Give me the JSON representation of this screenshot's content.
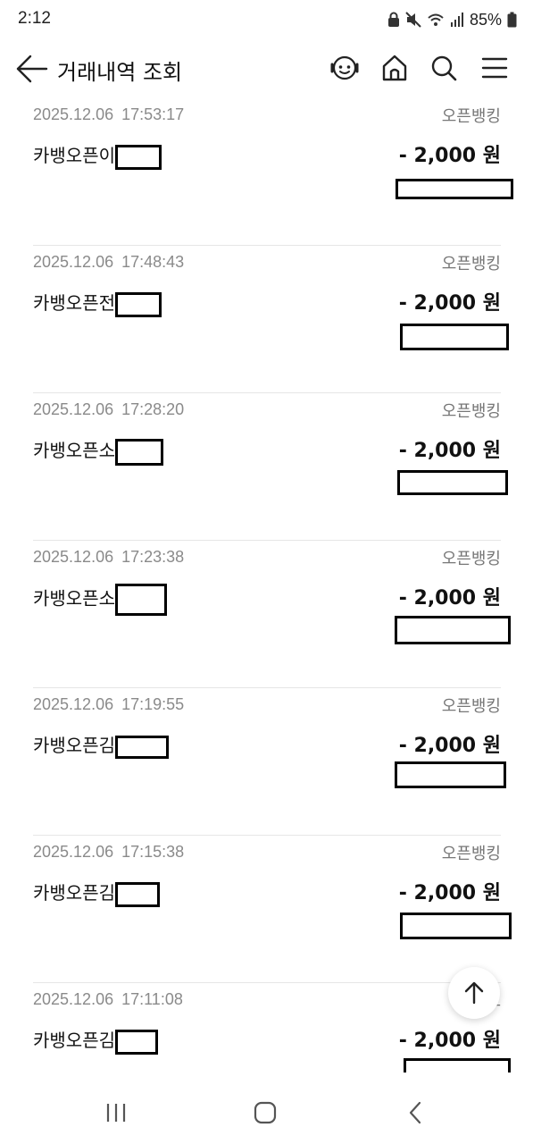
{
  "status_bar": {
    "time": "2:12",
    "battery": "85%",
    "icons": [
      "lock-icon",
      "mute-icon",
      "wifi-icon",
      "signal-icon",
      "battery-icon"
    ]
  },
  "header": {
    "title": "거래내역 조회",
    "icons": [
      "back-arrow-icon",
      "chatbot-face-icon",
      "home-icon",
      "search-icon",
      "menu-icon"
    ]
  },
  "transactions": [
    {
      "date": "2025.12.06",
      "time": "17:53:17",
      "type": "오픈뱅킹",
      "name": "카뱅오픈이",
      "amount": "- 2,000 원"
    },
    {
      "date": "2025.12.06",
      "time": "17:48:43",
      "type": "오픈뱅킹",
      "name": "카뱅오픈전",
      "amount": "- 2,000 원"
    },
    {
      "date": "2025.12.06",
      "time": "17:28:20",
      "type": "오픈뱅킹",
      "name": "카뱅오픈소",
      "amount": "- 2,000 원"
    },
    {
      "date": "2025.12.06",
      "time": "17:23:38",
      "type": "오픈뱅킹",
      "name": "카뱅오픈소",
      "amount": "- 2,000 원"
    },
    {
      "date": "2025.12.06",
      "time": "17:19:55",
      "type": "오픈뱅킹",
      "name": "카뱅오픈김",
      "amount": "- 2,000 원"
    },
    {
      "date": "2025.12.06",
      "time": "17:15:38",
      "type": "오픈뱅킹",
      "name": "카뱅오픈김",
      "amount": "- 2,000 원"
    },
    {
      "date": "2025.12.06",
      "time": "17:11:08",
      "type": "오",
      "name": "카뱅오픈김",
      "amount": "- 2,000 원"
    }
  ],
  "floating": {
    "icon": "arrow-up-icon"
  },
  "nav": {
    "icons": [
      "recent-apps-icon",
      "home-button-icon",
      "back-button-icon"
    ]
  },
  "colors": {
    "background": "#ffffff",
    "text": "#111111",
    "muted": "#8a8a8a",
    "divider": "#e6e6e6"
  }
}
